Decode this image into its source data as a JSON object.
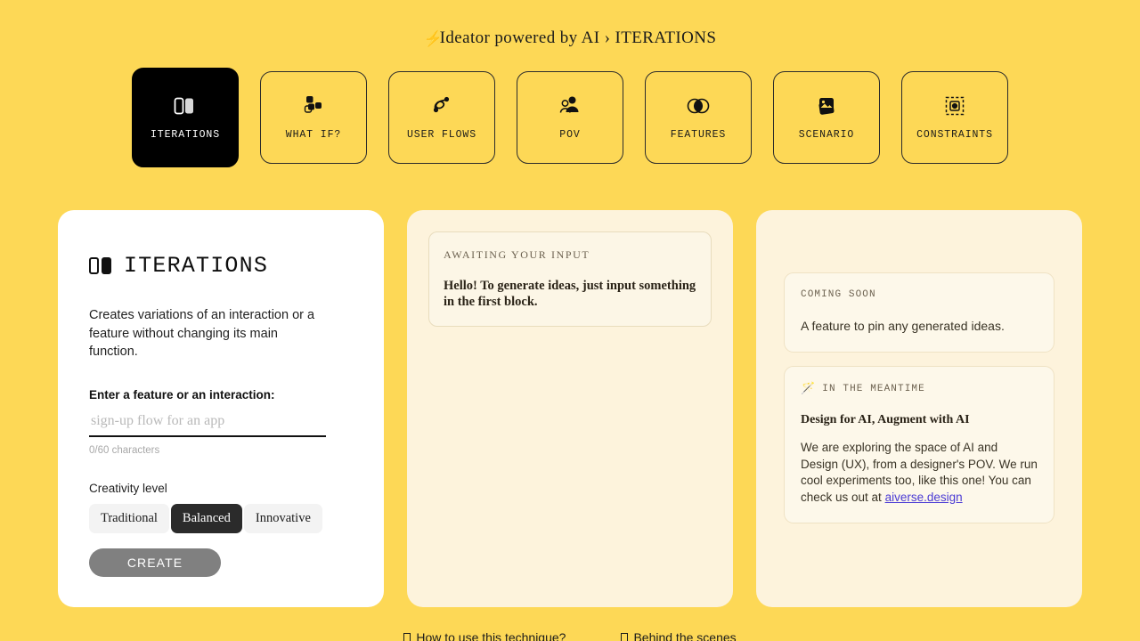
{
  "header": {
    "bolt_icon": "lightning-bolt-icon",
    "title": "Ideator powered by AI › ITERATIONS"
  },
  "tabs": [
    {
      "label": "ITERATIONS",
      "icon": "two-panels-icon",
      "active": true
    },
    {
      "label": "WHAT IF?",
      "icon": "scatter-dots-icon",
      "active": false
    },
    {
      "label": "USER FLOWS",
      "icon": "flow-nodes-icon",
      "active": false
    },
    {
      "label": "POV",
      "icon": "persons-icon",
      "active": false
    },
    {
      "label": "FEATURES",
      "icon": "venn-circles-icon",
      "active": false
    },
    {
      "label": "SCENARIO",
      "icon": "images-stack-icon",
      "active": false
    },
    {
      "label": "CONSTRAINTS",
      "icon": "dashed-target-icon",
      "active": false
    }
  ],
  "left_panel": {
    "title": "ITERATIONS",
    "title_icon": "two-panels-icon",
    "description": "Creates variations of an interaction or a feature without changing its main function.",
    "input_label": "Enter a feature or an interaction:",
    "input_value": "",
    "input_placeholder": "sign-up flow for an app",
    "char_count": "0/60 characters",
    "creativity_label": "Creativity level",
    "creativity_options": [
      "Traditional",
      "Balanced",
      "Innovative"
    ],
    "creativity_selected": "Balanced",
    "create_label": "CREATE"
  },
  "middle_panel": {
    "kicker": "AWAITING YOUR INPUT",
    "body": "Hello! To generate ideas, just input something in the first block."
  },
  "right_panel": {
    "coming_soon": {
      "kicker": "COMING SOON",
      "text": "A feature to pin any generated ideas."
    },
    "meantime": {
      "icon": "magic-wand-icon",
      "kicker": "IN THE MEANTIME",
      "heading": "Design for AI, Augment with AI",
      "paragraph": "We are exploring the space of AI and Design (UX), from a designer's POV. We run cool experiments too, like this one! You can check us out at ",
      "link": "aiverse.design"
    }
  },
  "footer": {
    "links": [
      {
        "label": "How to use this technique?"
      },
      {
        "label": "Behind the scenes"
      }
    ]
  },
  "colors": {
    "background": "#FDD856",
    "panel_cream": "#FDF3DC",
    "panel_white": "#FFFFFF",
    "active_tab": "#000000",
    "create_button": "#808080",
    "link": "#4B3BD4"
  }
}
